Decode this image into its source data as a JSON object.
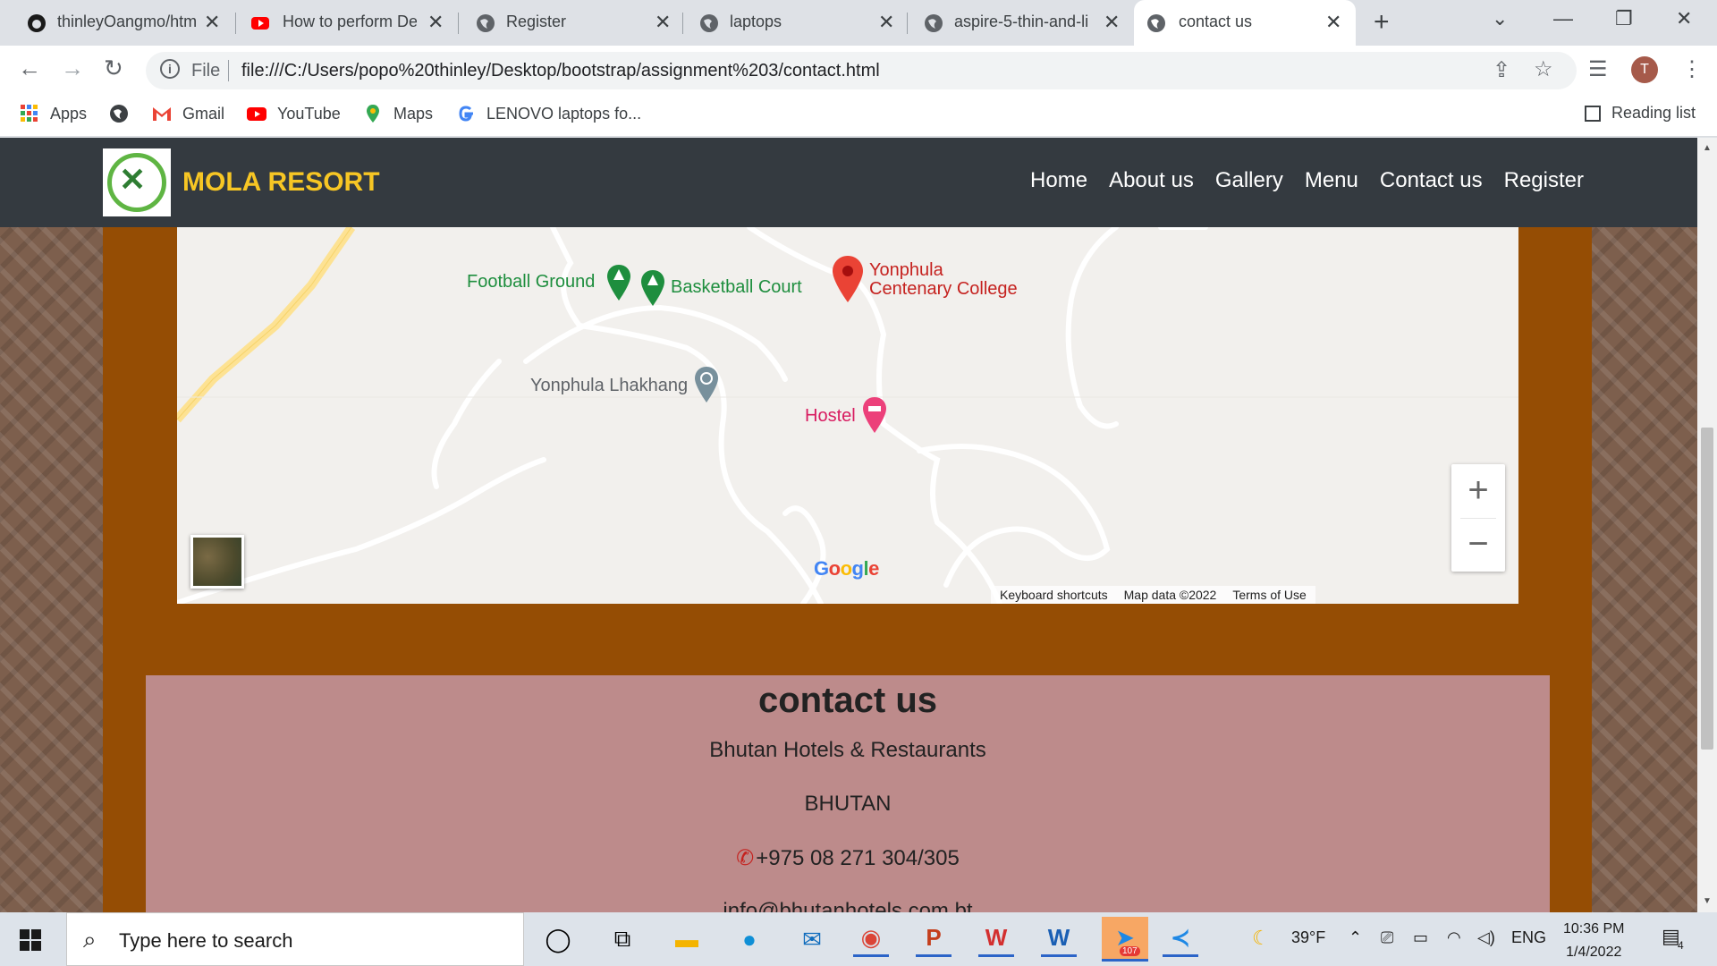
{
  "tabs": [
    {
      "title": "thinleyOangmo/htm",
      "icon": "github-icon"
    },
    {
      "title": "How to perform De",
      "icon": "youtube-icon"
    },
    {
      "title": "Register",
      "icon": "globe-icon"
    },
    {
      "title": "laptops",
      "icon": "globe-icon"
    },
    {
      "title": "aspire-5-thin-and-li",
      "icon": "globe-icon"
    },
    {
      "title": "contact us",
      "icon": "globe-icon",
      "active": true
    }
  ],
  "omnibox": {
    "scheme": "File",
    "url": "file:///C:/Users/popo%20thinley/Desktop/bootstrap/assignment%203/contact.html"
  },
  "profile_initial": "T",
  "bookmarks": [
    {
      "label": "Apps",
      "icon": "apps-grid-icon"
    },
    {
      "label": "",
      "icon": "globe-icon"
    },
    {
      "label": "Gmail",
      "icon": "gmail-icon"
    },
    {
      "label": "YouTube",
      "icon": "youtube-icon"
    },
    {
      "label": "Maps",
      "icon": "maps-pin-icon"
    },
    {
      "label": "LENOVO laptops fo...",
      "icon": "google-icon"
    }
  ],
  "reading_list": "Reading list",
  "site": {
    "brand": "MOLA RESORT",
    "nav": [
      "Home",
      "About us",
      "Gallery",
      "Menu",
      "Contact us",
      "Register"
    ]
  },
  "map": {
    "pois": {
      "football": "Football Ground",
      "basketball": "Basketball Court",
      "college_line1": "Yonphula",
      "college_line2": "Centenary College",
      "lhakhang": "Yonphula Lhakhang",
      "hostel": "Hostel"
    },
    "zoom_in": "+",
    "zoom_out": "−",
    "google_logo": "Google",
    "attribution": [
      "Keyboard shortcuts",
      "Map data ©2022",
      "Terms of Use"
    ]
  },
  "contact": {
    "heading": "contact us",
    "company": "Bhutan Hotels & Restaurants",
    "country": "BHUTAN",
    "phone": "+975 08 271 304/305",
    "email": "info@bhutanhotels.com.bt"
  },
  "taskbar": {
    "search_placeholder": "Type here to search",
    "weather": "39°F",
    "language": "ENG",
    "time": "10:36 PM",
    "date": "1/4/2022",
    "notifications": "4",
    "telegram_badge": "107"
  },
  "colors": {
    "navbar": "#343a40",
    "brand": "#f7c624",
    "container": "#954d04",
    "contact_bg": "#bd8b8b"
  }
}
